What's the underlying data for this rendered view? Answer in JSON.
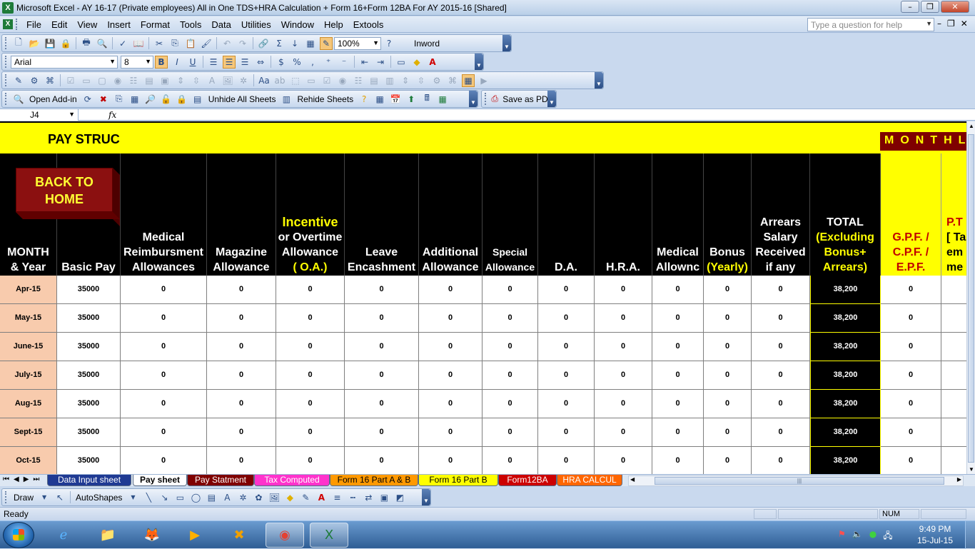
{
  "window": {
    "title": "Microsoft Excel - AY 16-17 (Private employees)  All in One TDS+HRA Calculation + Form 16+Form 12BA For AY 2015-16  [Shared]",
    "app_icon_letter": "X",
    "minimize": "–",
    "restore": "❐",
    "close": "✕"
  },
  "menu": {
    "items": [
      "File",
      "Edit",
      "View",
      "Insert",
      "Format",
      "Tools",
      "Data",
      "Utilities",
      "Window",
      "Help",
      "Extools"
    ],
    "help_placeholder": "Type a question for help"
  },
  "toolbar_standard": {
    "zoom": "100%",
    "inword": "Inword"
  },
  "toolbar_format": {
    "font": "Arial",
    "size": "8"
  },
  "toolbar_addins": {
    "open_addin": "Open Add-in",
    "unhide_all": "Unhide All Sheets",
    "rehide": "Rehide Sheets",
    "save_pdf": "Save as PDF"
  },
  "formula_bar": {
    "cell_ref": "J4",
    "fx": "fx",
    "content": ""
  },
  "sheet": {
    "banner_title": "PAY STRUC",
    "monthly_banner": "MONTHLY",
    "back_button_line1": "BACK TO",
    "back_button_line2": "HOME",
    "headers": {
      "month": [
        "MONTH",
        "& Year"
      ],
      "basic": [
        "Basic Pay"
      ],
      "medical_reimb": [
        "Medical",
        "Reimbursment",
        "Allowances"
      ],
      "magazine": [
        "Magazine",
        "Allowance"
      ],
      "incentive": [
        "Incentive",
        "or Overtime",
        "Allowance",
        "( O.A.)"
      ],
      "leave": [
        "Leave",
        "Encashment"
      ],
      "additional": [
        "Additional",
        "Allowance"
      ],
      "special": [
        "Special",
        "Allowance"
      ],
      "da": [
        "D.A."
      ],
      "hra": [
        "H.R.A."
      ],
      "medical_allow": [
        "Medical",
        "Allownc"
      ],
      "bonus": [
        "Bonus",
        "(Yearly)"
      ],
      "arrears": [
        "Arrears",
        "Salary",
        "Received",
        "if any"
      ],
      "total": [
        "TOTAL",
        "(Excluding",
        "Bonus+",
        "Arrears)"
      ],
      "gpf": [
        "G.P.F. /",
        "C.P.F. /",
        "E.P.F."
      ],
      "pt": [
        "P.T",
        "[ Ta",
        "em",
        "me"
      ]
    },
    "rows": [
      {
        "month": "Apr-15",
        "basic": "35000",
        "medical_reimb": "0",
        "magazine": "0",
        "incentive": "0",
        "leave": "0",
        "additional": "0",
        "special": "0",
        "da": "0",
        "hra": "0",
        "medical_allow": "0",
        "bonus": "0",
        "arrears": "0",
        "total": "38,200",
        "gpf": "0"
      },
      {
        "month": "May-15",
        "basic": "35000",
        "medical_reimb": "0",
        "magazine": "0",
        "incentive": "0",
        "leave": "0",
        "additional": "0",
        "special": "0",
        "da": "0",
        "hra": "0",
        "medical_allow": "0",
        "bonus": "0",
        "arrears": "0",
        "total": "38,200",
        "gpf": "0"
      },
      {
        "month": "June-15",
        "basic": "35000",
        "medical_reimb": "0",
        "magazine": "0",
        "incentive": "0",
        "leave": "0",
        "additional": "0",
        "special": "0",
        "da": "0",
        "hra": "0",
        "medical_allow": "0",
        "bonus": "0",
        "arrears": "0",
        "total": "38,200",
        "gpf": "0"
      },
      {
        "month": "July-15",
        "basic": "35000",
        "medical_reimb": "0",
        "magazine": "0",
        "incentive": "0",
        "leave": "0",
        "additional": "0",
        "special": "0",
        "da": "0",
        "hra": "0",
        "medical_allow": "0",
        "bonus": "0",
        "arrears": "0",
        "total": "38,200",
        "gpf": "0"
      },
      {
        "month": "Aug-15",
        "basic": "35000",
        "medical_reimb": "0",
        "magazine": "0",
        "incentive": "0",
        "leave": "0",
        "additional": "0",
        "special": "0",
        "da": "0",
        "hra": "0",
        "medical_allow": "0",
        "bonus": "0",
        "arrears": "0",
        "total": "38,200",
        "gpf": "0"
      },
      {
        "month": "Sept-15",
        "basic": "35000",
        "medical_reimb": "0",
        "magazine": "0",
        "incentive": "0",
        "leave": "0",
        "additional": "0",
        "special": "0",
        "da": "0",
        "hra": "0",
        "medical_allow": "0",
        "bonus": "0",
        "arrears": "0",
        "total": "38,200",
        "gpf": "0"
      },
      {
        "month": "Oct-15",
        "basic": "35000",
        "medical_reimb": "0",
        "magazine": "0",
        "incentive": "0",
        "leave": "0",
        "additional": "0",
        "special": "0",
        "da": "0",
        "hra": "0",
        "medical_allow": "0",
        "bonus": "0",
        "arrears": "0",
        "total": "38,200",
        "gpf": "0"
      }
    ]
  },
  "sheet_tabs": {
    "tabs": [
      {
        "label": "Data Input sheet",
        "bg": "#1f3a93",
        "fg": "#ffffff"
      },
      {
        "label": "Pay sheet",
        "bg": "#ffffff",
        "fg": "#000000"
      },
      {
        "label": "Pay Statment",
        "bg": "#7f0000",
        "fg": "#ffffff"
      },
      {
        "label": "Tax Computed",
        "bg": "#ff33cc",
        "fg": "#ffffff"
      },
      {
        "label": "Form 16 Part A & B",
        "bg": "#ff9900",
        "fg": "#000000"
      },
      {
        "label": "Form 16 Part B",
        "bg": "#ffff00",
        "fg": "#000000"
      },
      {
        "label": "Form12BA",
        "bg": "#cc0000",
        "fg": "#ffffff"
      },
      {
        "label": "HRA CALCUL",
        "bg": "#ff6600",
        "fg": "#ffffff"
      }
    ]
  },
  "drawing_toolbar": {
    "draw": "Draw",
    "autoshapes": "AutoShapes"
  },
  "status": {
    "ready": "Ready",
    "num": "NUM"
  },
  "taskbar": {
    "time": "9:49 PM",
    "date": "15-Jul-15"
  }
}
